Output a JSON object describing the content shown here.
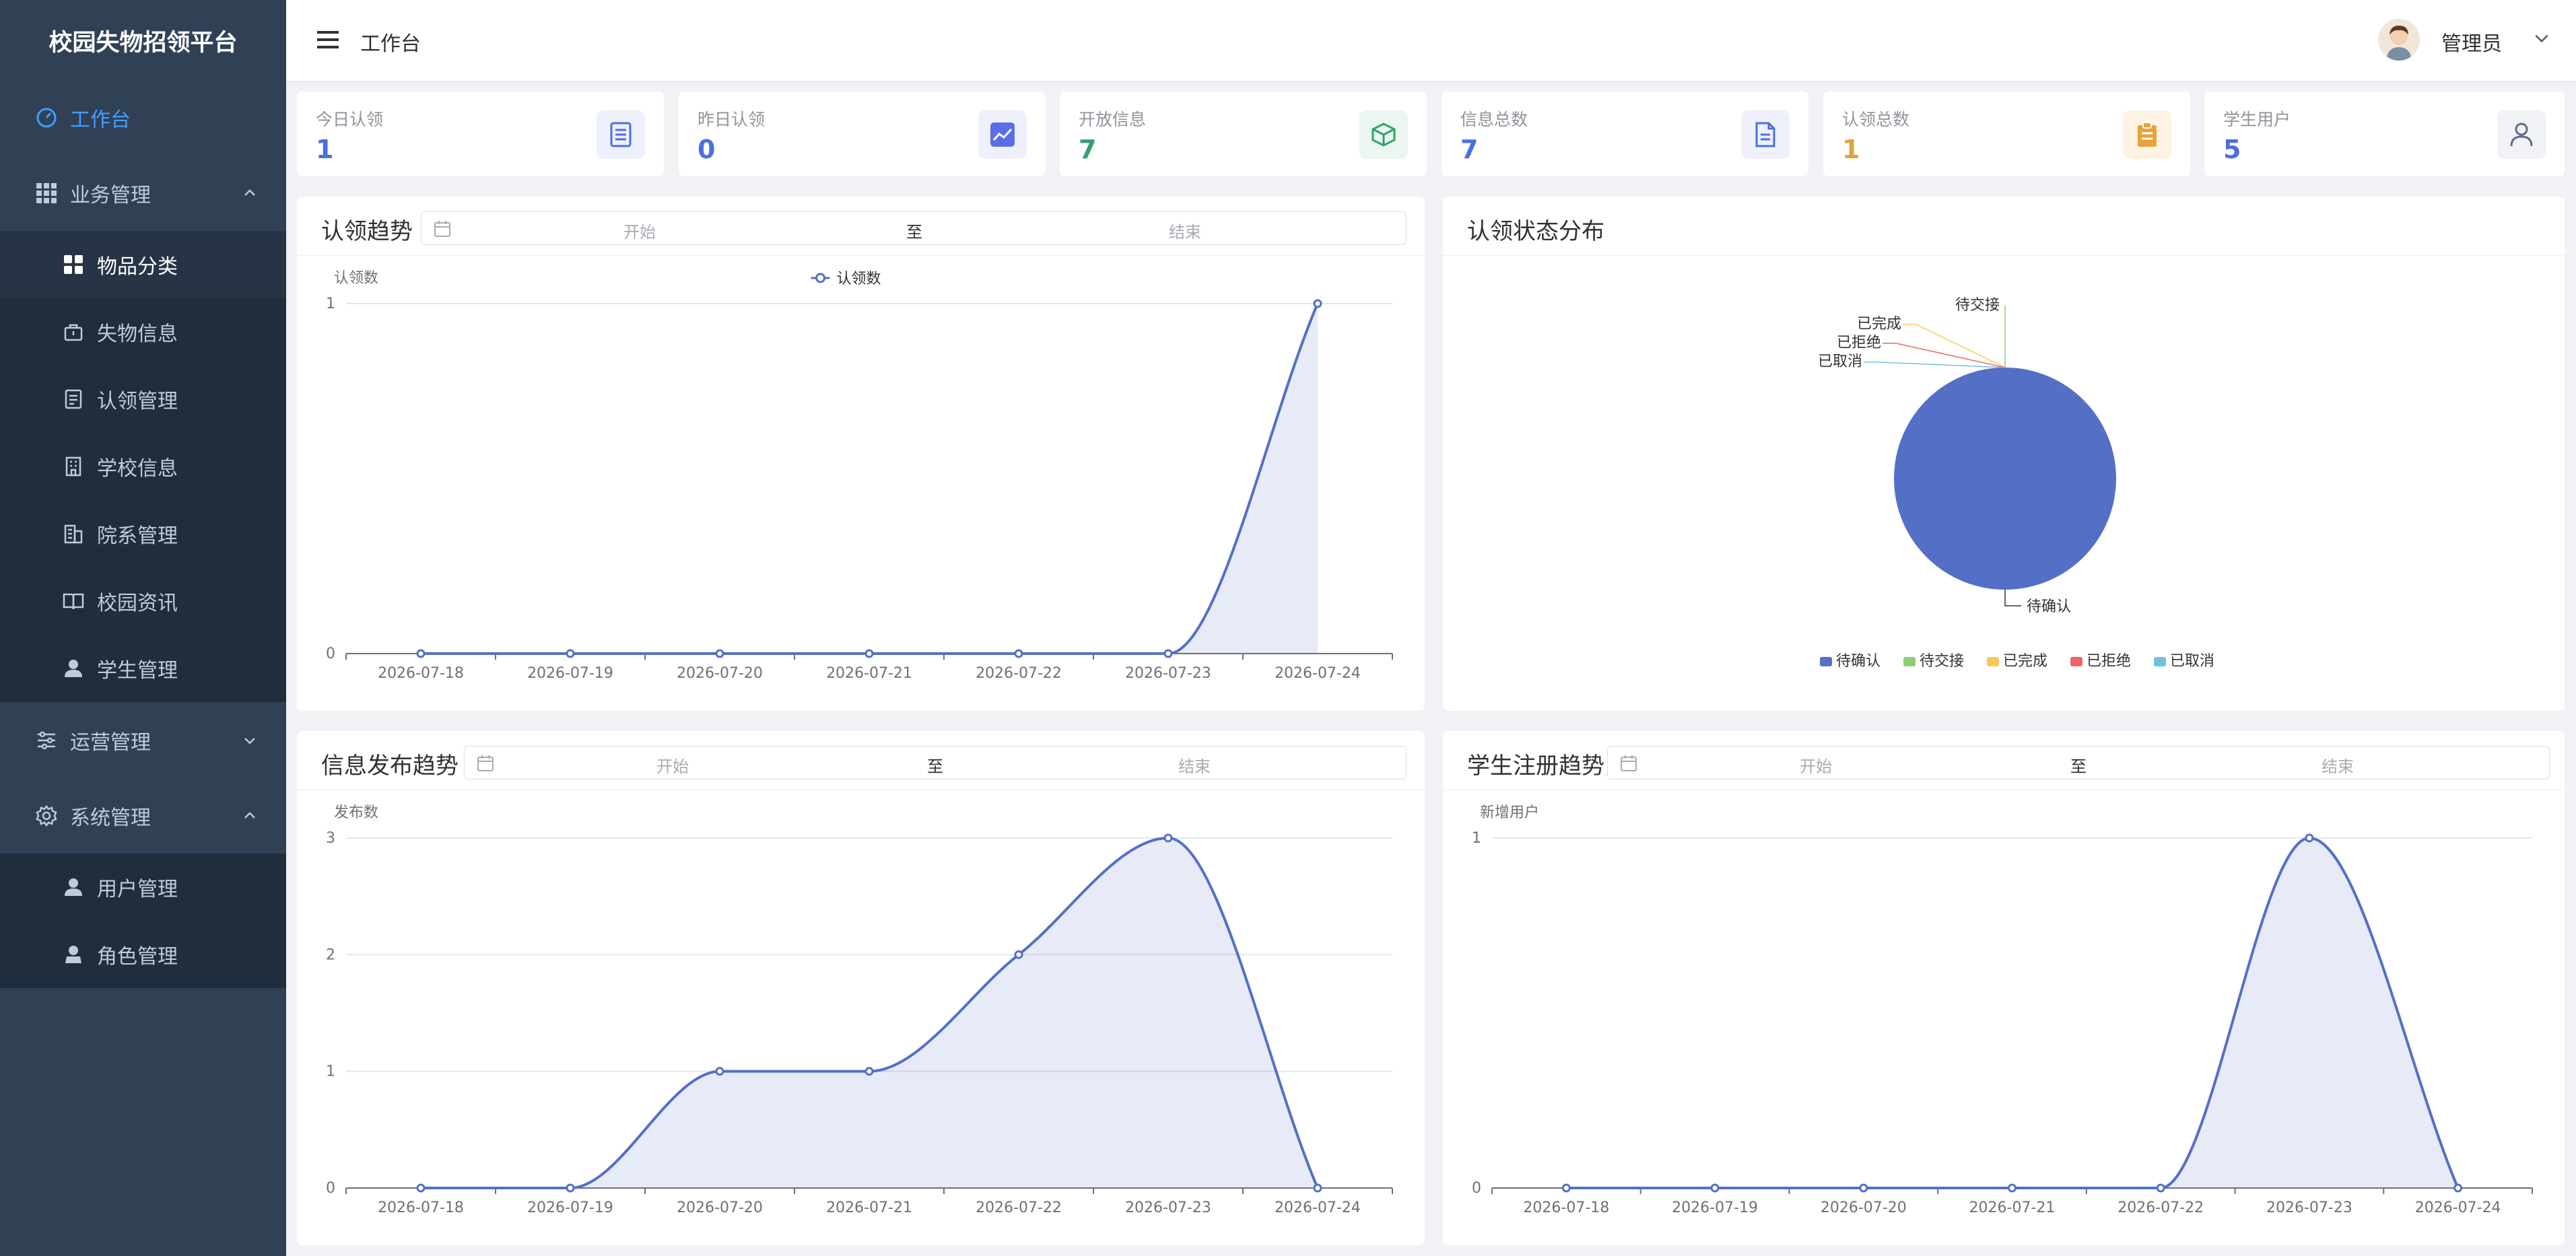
{
  "app": {
    "title": "校园失物招领平台"
  },
  "sidebar": {
    "items": [
      {
        "label": "工作台",
        "icon": "dashboard-icon"
      },
      {
        "label": "业务管理",
        "icon": "grid-icon"
      },
      {
        "label": "物品分类",
        "icon": "category-icon"
      },
      {
        "label": "失物信息",
        "icon": "bag-icon"
      },
      {
        "label": "认领管理",
        "icon": "document-icon"
      },
      {
        "label": "学校信息",
        "icon": "building-icon"
      },
      {
        "label": "院系管理",
        "icon": "office-icon"
      },
      {
        "label": "校园资讯",
        "icon": "book-icon"
      },
      {
        "label": "学生管理",
        "icon": "user-icon"
      },
      {
        "label": "运营管理",
        "icon": "sliders-icon"
      },
      {
        "label": "系统管理",
        "icon": "gear-icon"
      },
      {
        "label": "用户管理",
        "icon": "user-icon"
      },
      {
        "label": "角色管理",
        "icon": "role-icon"
      }
    ]
  },
  "header": {
    "title": "工作台",
    "user": "管理员"
  },
  "stats": [
    {
      "label": "今日认领",
      "value": "1",
      "color": "#4b6fe0",
      "icon": "document-icon"
    },
    {
      "label": "昨日认领",
      "value": "0",
      "color": "#4b6fe0",
      "icon": "trend-icon"
    },
    {
      "label": "开放信息",
      "value": "7",
      "color": "#2fa36b",
      "icon": "box-icon"
    },
    {
      "label": "信息总数",
      "value": "7",
      "color": "#4b6fe0",
      "icon": "file-icon"
    },
    {
      "label": "认领总数",
      "value": "1",
      "color": "#e6a23c",
      "icon": "clipboard-icon"
    },
    {
      "label": "学生用户",
      "value": "5",
      "color": "#4b6fe0",
      "icon": "user-icon"
    }
  ],
  "date_range": {
    "start": "开始",
    "sep": "至",
    "end": "结束"
  },
  "panels": {
    "claim_trend": {
      "title": "认领趋势"
    },
    "status_dist": {
      "title": "认领状态分布"
    },
    "publish_trend": {
      "title": "信息发布趋势"
    },
    "register_trend": {
      "title": "学生注册趋势"
    }
  },
  "chart_data": [
    {
      "type": "area",
      "title": "认领趋势",
      "ylabel": "认领数",
      "x": [
        "2026-07-18",
        "2026-07-19",
        "2026-07-20",
        "2026-07-21",
        "2026-07-22",
        "2026-07-23",
        "2026-07-24"
      ],
      "series": [
        {
          "name": "认领数",
          "values": [
            0,
            0,
            0,
            0,
            0,
            0,
            1
          ]
        }
      ],
      "ylim": [
        0,
        1
      ],
      "yticks": [
        0,
        1
      ],
      "legend": "top-center",
      "color": "#5470c6"
    },
    {
      "type": "pie",
      "title": "认领状态分布",
      "categories": [
        "待确认",
        "待交接",
        "已完成",
        "已拒绝",
        "已取消"
      ],
      "values": [
        1,
        0,
        0,
        0,
        0
      ],
      "colors": [
        "#5470c6",
        "#91cc75",
        "#fac858",
        "#ee6666",
        "#73c0de"
      ],
      "legend": "bottom-center"
    },
    {
      "type": "area",
      "title": "信息发布趋势",
      "ylabel": "发布数",
      "x": [
        "2026-07-18",
        "2026-07-19",
        "2026-07-20",
        "2026-07-21",
        "2026-07-22",
        "2026-07-23",
        "2026-07-24"
      ],
      "series": [
        {
          "values": [
            0,
            0,
            1,
            1,
            2,
            3,
            0
          ]
        }
      ],
      "ylim": [
        0,
        3
      ],
      "yticks": [
        0,
        1,
        2,
        3
      ],
      "color": "#5470c6"
    },
    {
      "type": "area",
      "title": "学生注册趋势",
      "ylabel": "新增用户",
      "x": [
        "2026-07-18",
        "2026-07-19",
        "2026-07-20",
        "2026-07-21",
        "2026-07-22",
        "2026-07-23",
        "2026-07-24"
      ],
      "series": [
        {
          "values": [
            0,
            0,
            0,
            0,
            0,
            1,
            0
          ]
        }
      ],
      "ylim": [
        0,
        1
      ],
      "yticks": [
        0,
        1
      ],
      "color": "#5470c6"
    }
  ]
}
